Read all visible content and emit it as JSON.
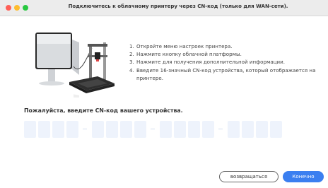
{
  "window": {
    "title": "Подключитесь к облачному принтеру через CN-код (только для WAN-сети)."
  },
  "instructions": {
    "steps": [
      {
        "num": "1.",
        "text": "Откройте меню настроек принтера."
      },
      {
        "num": "2.",
        "text": "Нажмите кнопку облачной платформы."
      },
      {
        "num": "3.",
        "text": "Нажмите для получения дополнительной информации."
      },
      {
        "num": "4.",
        "text": "Введите 16-значный CN-код устройства, который отображается на принтере."
      }
    ]
  },
  "code_input": {
    "prompt": "Пожалуйста, введите CN-код вашего устройства.",
    "values": [
      "",
      "",
      "",
      "",
      "",
      "",
      "",
      "",
      "",
      "",
      "",
      "",
      "",
      "",
      "",
      ""
    ]
  },
  "buttons": {
    "back": "возвращаться",
    "ok": "Конечно"
  },
  "colors": {
    "accent": "#3b7ff0",
    "code_cell": "#eef3fc"
  }
}
